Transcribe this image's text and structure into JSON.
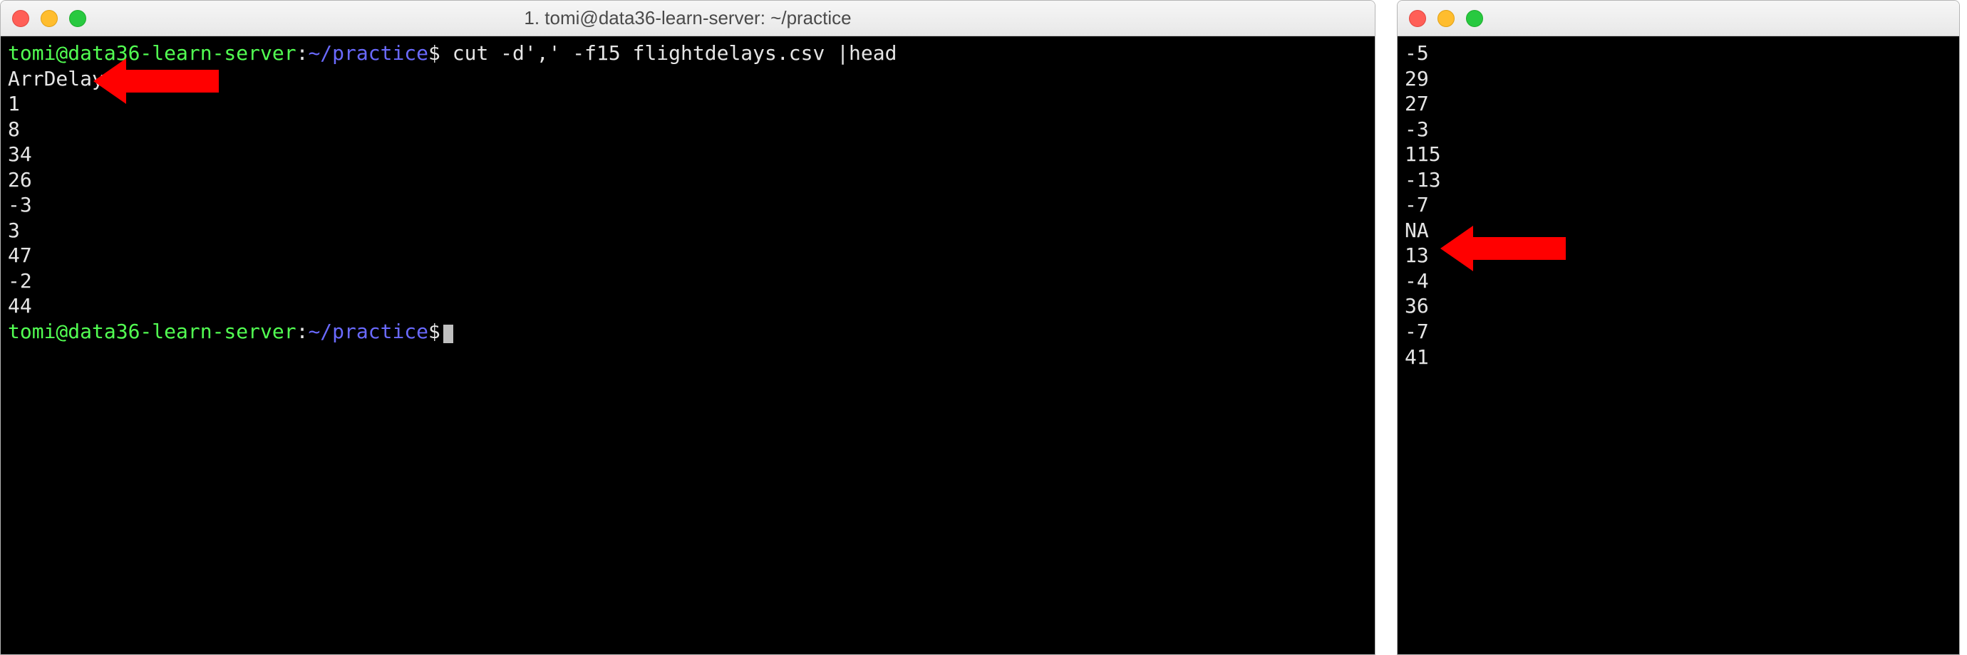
{
  "left": {
    "title": "1. tomi@data36-learn-server: ~/practice",
    "prompt": {
      "user_host": "tomi@data36-learn-server",
      "colon": ":",
      "path": "~/practice",
      "dollar": "$"
    },
    "command": " cut -d',' -f15 flightdelays.csv |head",
    "output": [
      "ArrDelay",
      "1",
      "8",
      "34",
      "26",
      "-3",
      "3",
      "47",
      "-2",
      "44"
    ],
    "arrow_target": "ArrDelay"
  },
  "right": {
    "output": [
      "-5",
      "29",
      "27",
      "-3",
      "115",
      "-13",
      "-7",
      "NA",
      "13",
      "-4",
      "36",
      "-7",
      "41"
    ],
    "arrow_target": "NA"
  }
}
